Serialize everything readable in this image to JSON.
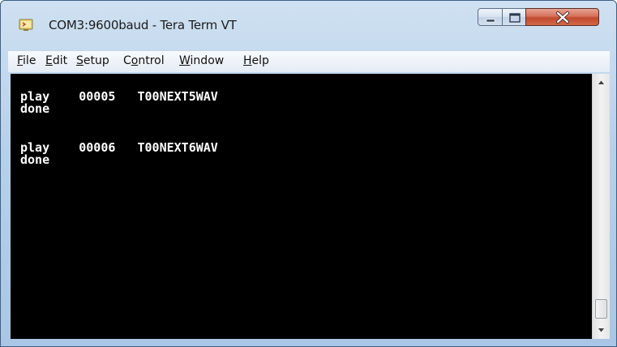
{
  "window": {
    "title": "COM3:9600baud - Tera Term VT",
    "icon": "tera-term-app-icon"
  },
  "caption_buttons": {
    "minimize_icon": "minimize-icon",
    "maximize_icon": "maximize-icon",
    "close_icon": "close-icon"
  },
  "menu": {
    "items": [
      {
        "accel": "F",
        "rest": "ile"
      },
      {
        "accel": "E",
        "rest": "dit"
      },
      {
        "accel": "S",
        "rest": "etup"
      },
      {
        "pre": "C",
        "accel": "o",
        "rest": "ntrol"
      },
      {
        "accel": "W",
        "rest": "indow"
      },
      {
        "accel": "H",
        "rest": "elp"
      }
    ]
  },
  "terminal": {
    "background": "#000000",
    "foreground": "#ffffff",
    "lines": [
      "play    00005   T00NEXT5WAV",
      "done",
      "",
      "play    00006   T00NEXT6WAV",
      "done"
    ]
  },
  "scrollbar": {
    "up_icon": "scroll-up-arrow-icon",
    "down_icon": "scroll-down-arrow-icon"
  },
  "colors": {
    "frame": "#b8d1ea",
    "close_button": "#c14a30"
  }
}
